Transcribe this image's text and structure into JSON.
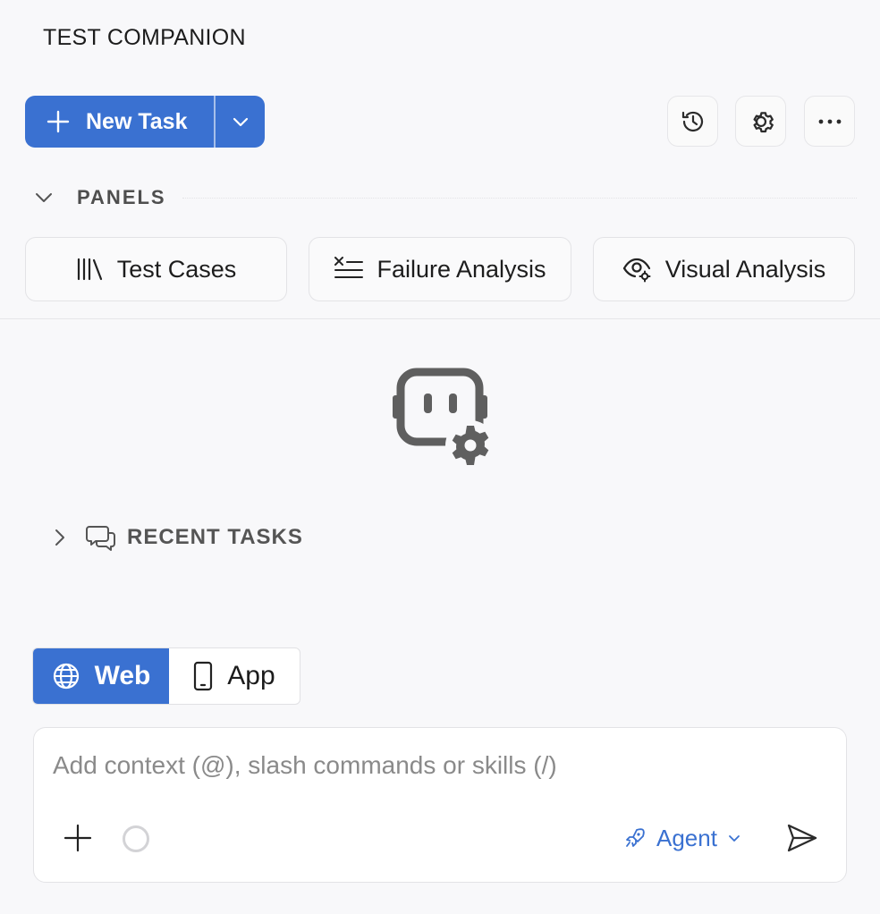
{
  "app": {
    "title": "TEST COMPANION"
  },
  "toolbar": {
    "new_task_label": "New Task",
    "buttons": [
      {
        "name": "history-icon"
      },
      {
        "name": "settings-gear-icon"
      },
      {
        "name": "more-icon"
      }
    ]
  },
  "panels": {
    "header_label": "PANELS",
    "items": [
      {
        "label": "Test Cases",
        "icon": "library-icon"
      },
      {
        "label": "Failure Analysis",
        "icon": "list-x-icon"
      },
      {
        "label": "Visual Analysis",
        "icon": "eye-settings-icon"
      }
    ]
  },
  "hero": {
    "icon": "bot-settings-icon"
  },
  "recent_tasks": {
    "label": "RECENT TASKS",
    "expanded": false
  },
  "mode": {
    "options": [
      {
        "label": "Web",
        "icon": "globe-icon",
        "selected": true
      },
      {
        "label": "App",
        "icon": "phone-icon",
        "selected": false
      }
    ]
  },
  "composer": {
    "placeholder": "Add context (@), slash commands or skills (/)",
    "value": "",
    "agent_label": "Agent"
  },
  "colors": {
    "accent": "#3a71d1",
    "background": "#f8f8fa",
    "border": "#e3e3e6"
  }
}
